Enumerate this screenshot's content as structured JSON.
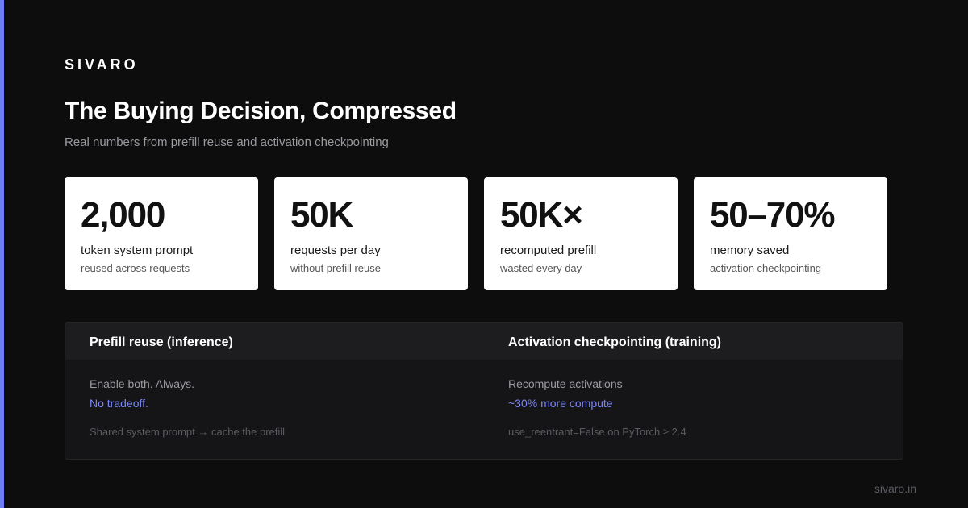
{
  "brand": "SIVARO",
  "title": "The Buying Decision, Compressed",
  "subtitle": "Real numbers from prefill reuse and activation checkpointing",
  "cards": [
    {
      "value": "2,000",
      "label": "token system prompt",
      "sub": "reused across requests"
    },
    {
      "value": "50K",
      "label": "requests per day",
      "sub": "without prefill reuse"
    },
    {
      "value": "50K×",
      "label": "recomputed prefill",
      "sub": "wasted every day"
    },
    {
      "value": "50–70%",
      "label": "memory saved",
      "sub": "activation checkpointing"
    }
  ],
  "comparison": [
    {
      "heading": "Prefill reuse (inference)",
      "main": "Enable both. Always.",
      "accent": "No tradeoff.",
      "note": "Shared system prompt → cache the prefill"
    },
    {
      "heading": "Activation checkpointing (training)",
      "main": "Recompute activations",
      "accent": "~30% more compute",
      "note": "use_reentrant=False on PyTorch ≥ 2.4"
    }
  ],
  "footer": "sivaro.in",
  "colors": {
    "background": "#0d0d0d",
    "accent": "#6d7ff5",
    "accent_text": "#7b86f7",
    "card": "#ffffff"
  }
}
